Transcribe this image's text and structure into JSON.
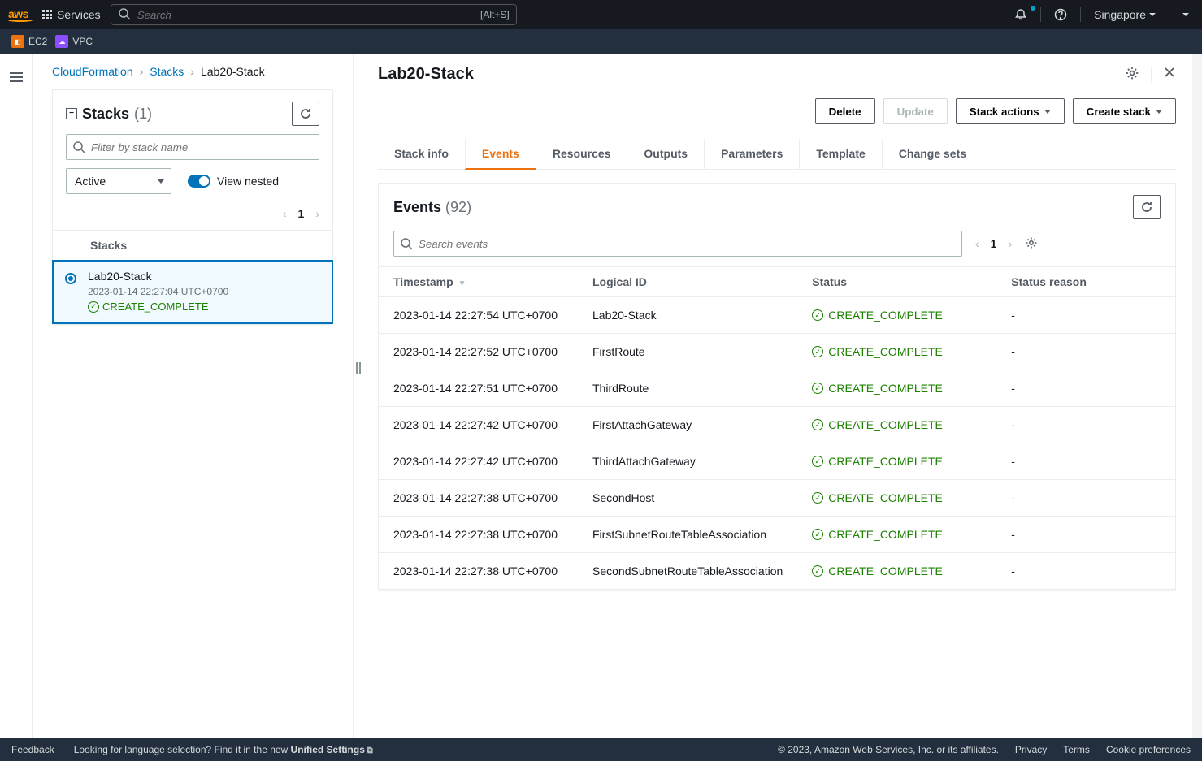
{
  "topnav": {
    "services_label": "Services",
    "search_placeholder": "Search",
    "search_kbd": "[Alt+S]",
    "region": "Singapore"
  },
  "servicebar": {
    "ec2": "EC2",
    "vpc": "VPC"
  },
  "breadcrumb": {
    "root": "CloudFormation",
    "mid": "Stacks",
    "leaf": "Lab20-Stack"
  },
  "left": {
    "title": "Stacks",
    "count": "(1)",
    "filter_placeholder": "Filter by stack name",
    "status_filter": "Active",
    "view_nested": "View nested",
    "page": "1",
    "list_header": "Stacks",
    "item": {
      "name": "Lab20-Stack",
      "date": "2023-01-14 22:27:04 UTC+0700",
      "status": "CREATE_COMPLETE"
    }
  },
  "right": {
    "title": "Lab20-Stack",
    "buttons": {
      "delete": "Delete",
      "update": "Update",
      "actions": "Stack actions",
      "create": "Create stack"
    },
    "tabs": {
      "info": "Stack info",
      "events": "Events",
      "resources": "Resources",
      "outputs": "Outputs",
      "parameters": "Parameters",
      "template": "Template",
      "changesets": "Change sets"
    },
    "events": {
      "title": "Events",
      "count": "(92)",
      "search_placeholder": "Search events",
      "page": "1",
      "columns": {
        "ts": "Timestamp",
        "lid": "Logical ID",
        "status": "Status",
        "reason": "Status reason"
      },
      "rows": [
        {
          "ts": "2023-01-14 22:27:54 UTC+0700",
          "lid": "Lab20-Stack",
          "status": "CREATE_COMPLETE",
          "reason": "-"
        },
        {
          "ts": "2023-01-14 22:27:52 UTC+0700",
          "lid": "FirstRoute",
          "status": "CREATE_COMPLETE",
          "reason": "-"
        },
        {
          "ts": "2023-01-14 22:27:51 UTC+0700",
          "lid": "ThirdRoute",
          "status": "CREATE_COMPLETE",
          "reason": "-"
        },
        {
          "ts": "2023-01-14 22:27:42 UTC+0700",
          "lid": "FirstAttachGateway",
          "status": "CREATE_COMPLETE",
          "reason": "-"
        },
        {
          "ts": "2023-01-14 22:27:42 UTC+0700",
          "lid": "ThirdAttachGateway",
          "status": "CREATE_COMPLETE",
          "reason": "-"
        },
        {
          "ts": "2023-01-14 22:27:38 UTC+0700",
          "lid": "SecondHost",
          "status": "CREATE_COMPLETE",
          "reason": "-"
        },
        {
          "ts": "2023-01-14 22:27:38 UTC+0700",
          "lid": "FirstSubnetRouteTableAssociation",
          "status": "CREATE_COMPLETE",
          "reason": "-"
        },
        {
          "ts": "2023-01-14 22:27:38 UTC+0700",
          "lid": "SecondSubnetRouteTableAssociation",
          "status": "CREATE_COMPLETE",
          "reason": "-"
        }
      ]
    }
  },
  "footer": {
    "feedback": "Feedback",
    "lang_hint": "Looking for language selection? Find it in the new ",
    "unified": "Unified Settings",
    "copyright": "© 2023, Amazon Web Services, Inc. or its affiliates.",
    "privacy": "Privacy",
    "terms": "Terms",
    "cookies": "Cookie preferences"
  }
}
